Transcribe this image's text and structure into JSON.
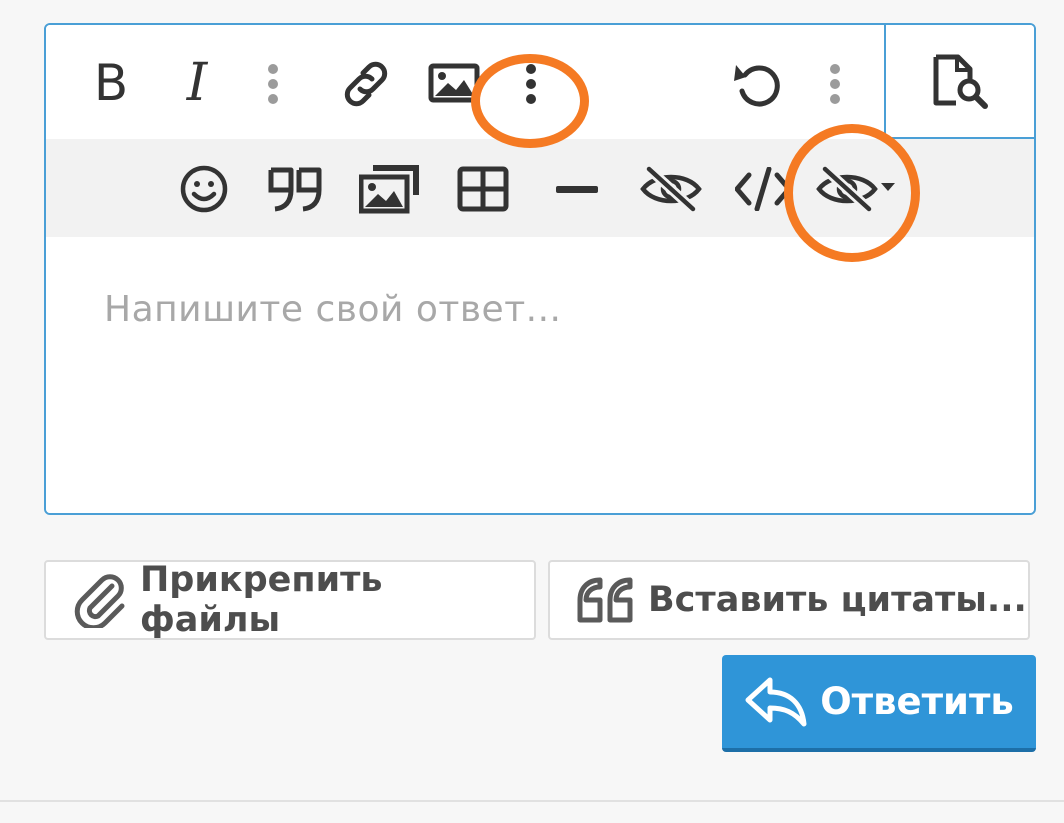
{
  "editor": {
    "toolbar_main": [
      {
        "name": "bold-button",
        "icon": "bold-icon",
        "glyph": "B"
      },
      {
        "name": "italic-button",
        "icon": "italic-icon",
        "glyph": "I"
      },
      {
        "name": "more-text-button",
        "icon": "vertical-ellipsis-icon"
      },
      {
        "name": "link-button",
        "icon": "link-icon"
      },
      {
        "name": "image-button",
        "icon": "image-icon"
      },
      {
        "name": "more-insert-button",
        "icon": "vertical-ellipsis-icon"
      },
      {
        "name": "undo-button",
        "icon": "undo-icon"
      },
      {
        "name": "more-options-button",
        "icon": "vertical-ellipsis-icon"
      },
      {
        "name": "preview-button",
        "icon": "file-search-icon"
      }
    ],
    "toolbar_sub": [
      {
        "name": "emoji-button",
        "icon": "smiley-icon"
      },
      {
        "name": "quote-button",
        "icon": "quote-icon"
      },
      {
        "name": "gallery-button",
        "icon": "gallery-icon"
      },
      {
        "name": "table-button",
        "icon": "table-icon"
      },
      {
        "name": "horizontal-rule-button",
        "icon": "minus-icon"
      },
      {
        "name": "spoiler-button",
        "icon": "eye-slash-icon"
      },
      {
        "name": "code-button",
        "icon": "code-icon"
      },
      {
        "name": "hide-dropdown-button",
        "icon": "eye-slash-dropdown-icon"
      }
    ],
    "placeholder": "Напишите свой ответ..."
  },
  "actions": {
    "attach_label": "Прикрепить файлы",
    "insert_quotes_label": "Вставить цитаты...",
    "reply_label": "Ответить"
  },
  "colors": {
    "accent": "#4a9fd6",
    "primary_button": "#2f95d8",
    "highlight": "#f57a23",
    "icon": "#3a3a3a"
  }
}
